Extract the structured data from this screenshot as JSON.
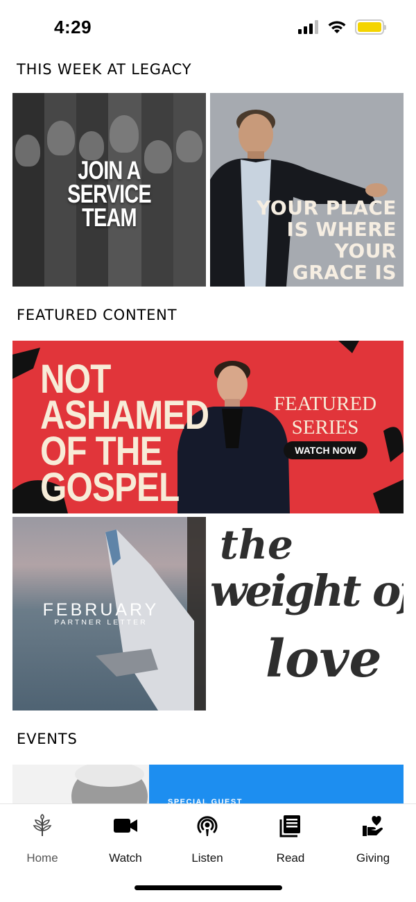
{
  "status_bar": {
    "time": "4:29",
    "battery_color": "#f4d400"
  },
  "sections": {
    "this_week": "THIS WEEK AT LEGACY",
    "featured": "FEATURED CONTENT",
    "events": "EVENTS"
  },
  "this_week_tiles": {
    "join": {
      "lines": [
        "JOIN A",
        "SERVICE",
        "TEAM"
      ]
    },
    "place": {
      "lines": [
        "YOUR PLACE",
        "IS WHERE",
        "YOUR",
        "GRACE IS"
      ]
    }
  },
  "featured_banner": {
    "title_lines": [
      "NOT",
      "ASHAMED",
      "OF THE",
      "GOSPEL"
    ],
    "label_lines": [
      "FEATURED",
      "SERIES"
    ],
    "cta": "WATCH NOW",
    "background_color": "#e1353a"
  },
  "content_tiles": {
    "letter": {
      "title": "FEBRUARY",
      "subtitle": "PARTNER LETTER"
    },
    "weight": {
      "lines": [
        "the",
        "weight of",
        "love"
      ]
    }
  },
  "event_tile": {
    "tag": "SPECIAL GUEST",
    "accent_color": "#1d8ef0"
  },
  "tab_bar": {
    "items": [
      {
        "label": "Home",
        "icon": "leaf-icon"
      },
      {
        "label": "Watch",
        "icon": "video-camera-icon"
      },
      {
        "label": "Listen",
        "icon": "podcast-icon"
      },
      {
        "label": "Read",
        "icon": "book-icon"
      },
      {
        "label": "Giving",
        "icon": "heart-hand-icon"
      }
    ]
  }
}
